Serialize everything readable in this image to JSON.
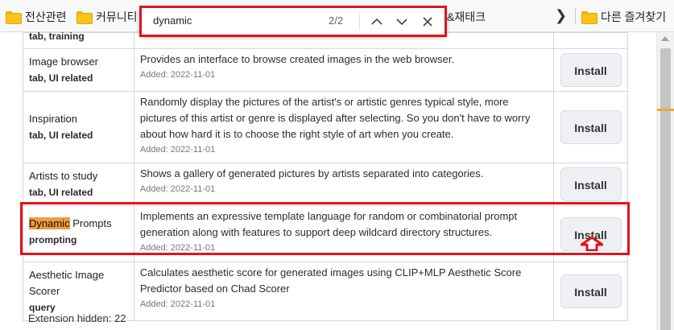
{
  "bookmarks": {
    "items": [
      {
        "label": "전산관련"
      },
      {
        "label": "커뮤니티"
      },
      {
        "label": "&재태크"
      }
    ],
    "other_label": "다른 즐겨찾기"
  },
  "find": {
    "query": "dynamic",
    "count": "2/2"
  },
  "table": {
    "top_tags": "tab, training",
    "rows": [
      {
        "name": "Image browser",
        "tags": "tab, UI related",
        "description": "Provides an interface to browse created images in the web browser.",
        "added": "Added: 2022-11-01",
        "button": "Install"
      },
      {
        "name": "Inspiration",
        "tags": "tab, UI related",
        "description": "Randomly display the pictures of the artist's or artistic genres typical style, more pictures of this artist or genre is displayed after selecting. So you don't have to worry about how hard it is to choose the right style of art when you create.",
        "added": "Added: 2022-11-01",
        "button": "Install"
      },
      {
        "name": "Artists to study",
        "tags": "tab, UI related",
        "description": "Shows a gallery of generated pictures by artists separated into categories.",
        "added": "Added: 2022-11-01",
        "button": "Install"
      },
      {
        "name_highlight": "Dynamic",
        "name_rest": " Prompts",
        "tags": "prompting",
        "description": "Implements an expressive template language for random or combinatorial prompt generation along with features to support deep wildcard directory structures.",
        "added": "Added: 2022-11-01",
        "button": "Install"
      },
      {
        "name": "Aesthetic Image Scorer",
        "tags": "query",
        "description": "Calculates aesthetic score for generated images using CLIP+MLP Aesthetic Score Predictor based on Chad Scorer",
        "added": "Added: 2022-11-01",
        "button": "Install"
      }
    ],
    "hidden_count": "Extension hidden: 22"
  },
  "colors": {
    "highlight": "#f09d3a",
    "annotation_red": "#e0121d"
  }
}
